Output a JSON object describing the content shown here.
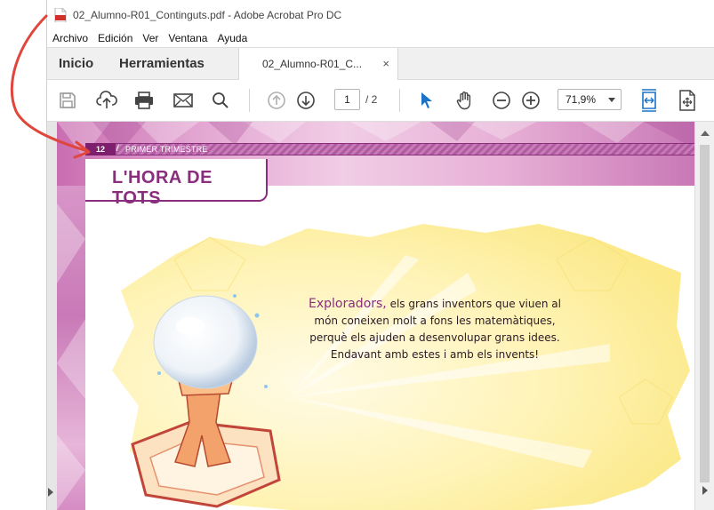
{
  "window": {
    "title": "02_Alumno-R01_Continguts.pdf - Adobe Acrobat Pro DC"
  },
  "menu": [
    "Archivo",
    "Edición",
    "Ver",
    "Ventana",
    "Ayuda"
  ],
  "tabs": {
    "home": "Inicio",
    "tools": "Herramientas",
    "document": "02_Alumno-R01_C...",
    "close": "×"
  },
  "toolbar": {
    "icons": [
      "save-icon",
      "upload-icon",
      "print-icon",
      "email-icon",
      "search-icon",
      "page-up-icon",
      "page-down-icon",
      "select-cursor-icon",
      "hand-tool-icon",
      "zoom-out-icon",
      "zoom-in-icon",
      "fit-width-icon",
      "page-tools-icon"
    ],
    "page_current": "1",
    "page_total": "/ 2",
    "zoom": "71,9%"
  },
  "page": {
    "number": "12",
    "section": "PRIMER TRIMESTRE",
    "title": "L'HORA DE TOTS",
    "lead": "Exploradors,",
    "body": "els grans inventors que viuen al món coneixen molt a fons les matemàtiques, perquè els ajuden a desenvolupar grans idees. Endavant amb estes i amb els invents!"
  },
  "colors": {
    "accent": "#8a2d7d",
    "annotation": "#e0463c",
    "select_blue": "#1a73c7"
  }
}
